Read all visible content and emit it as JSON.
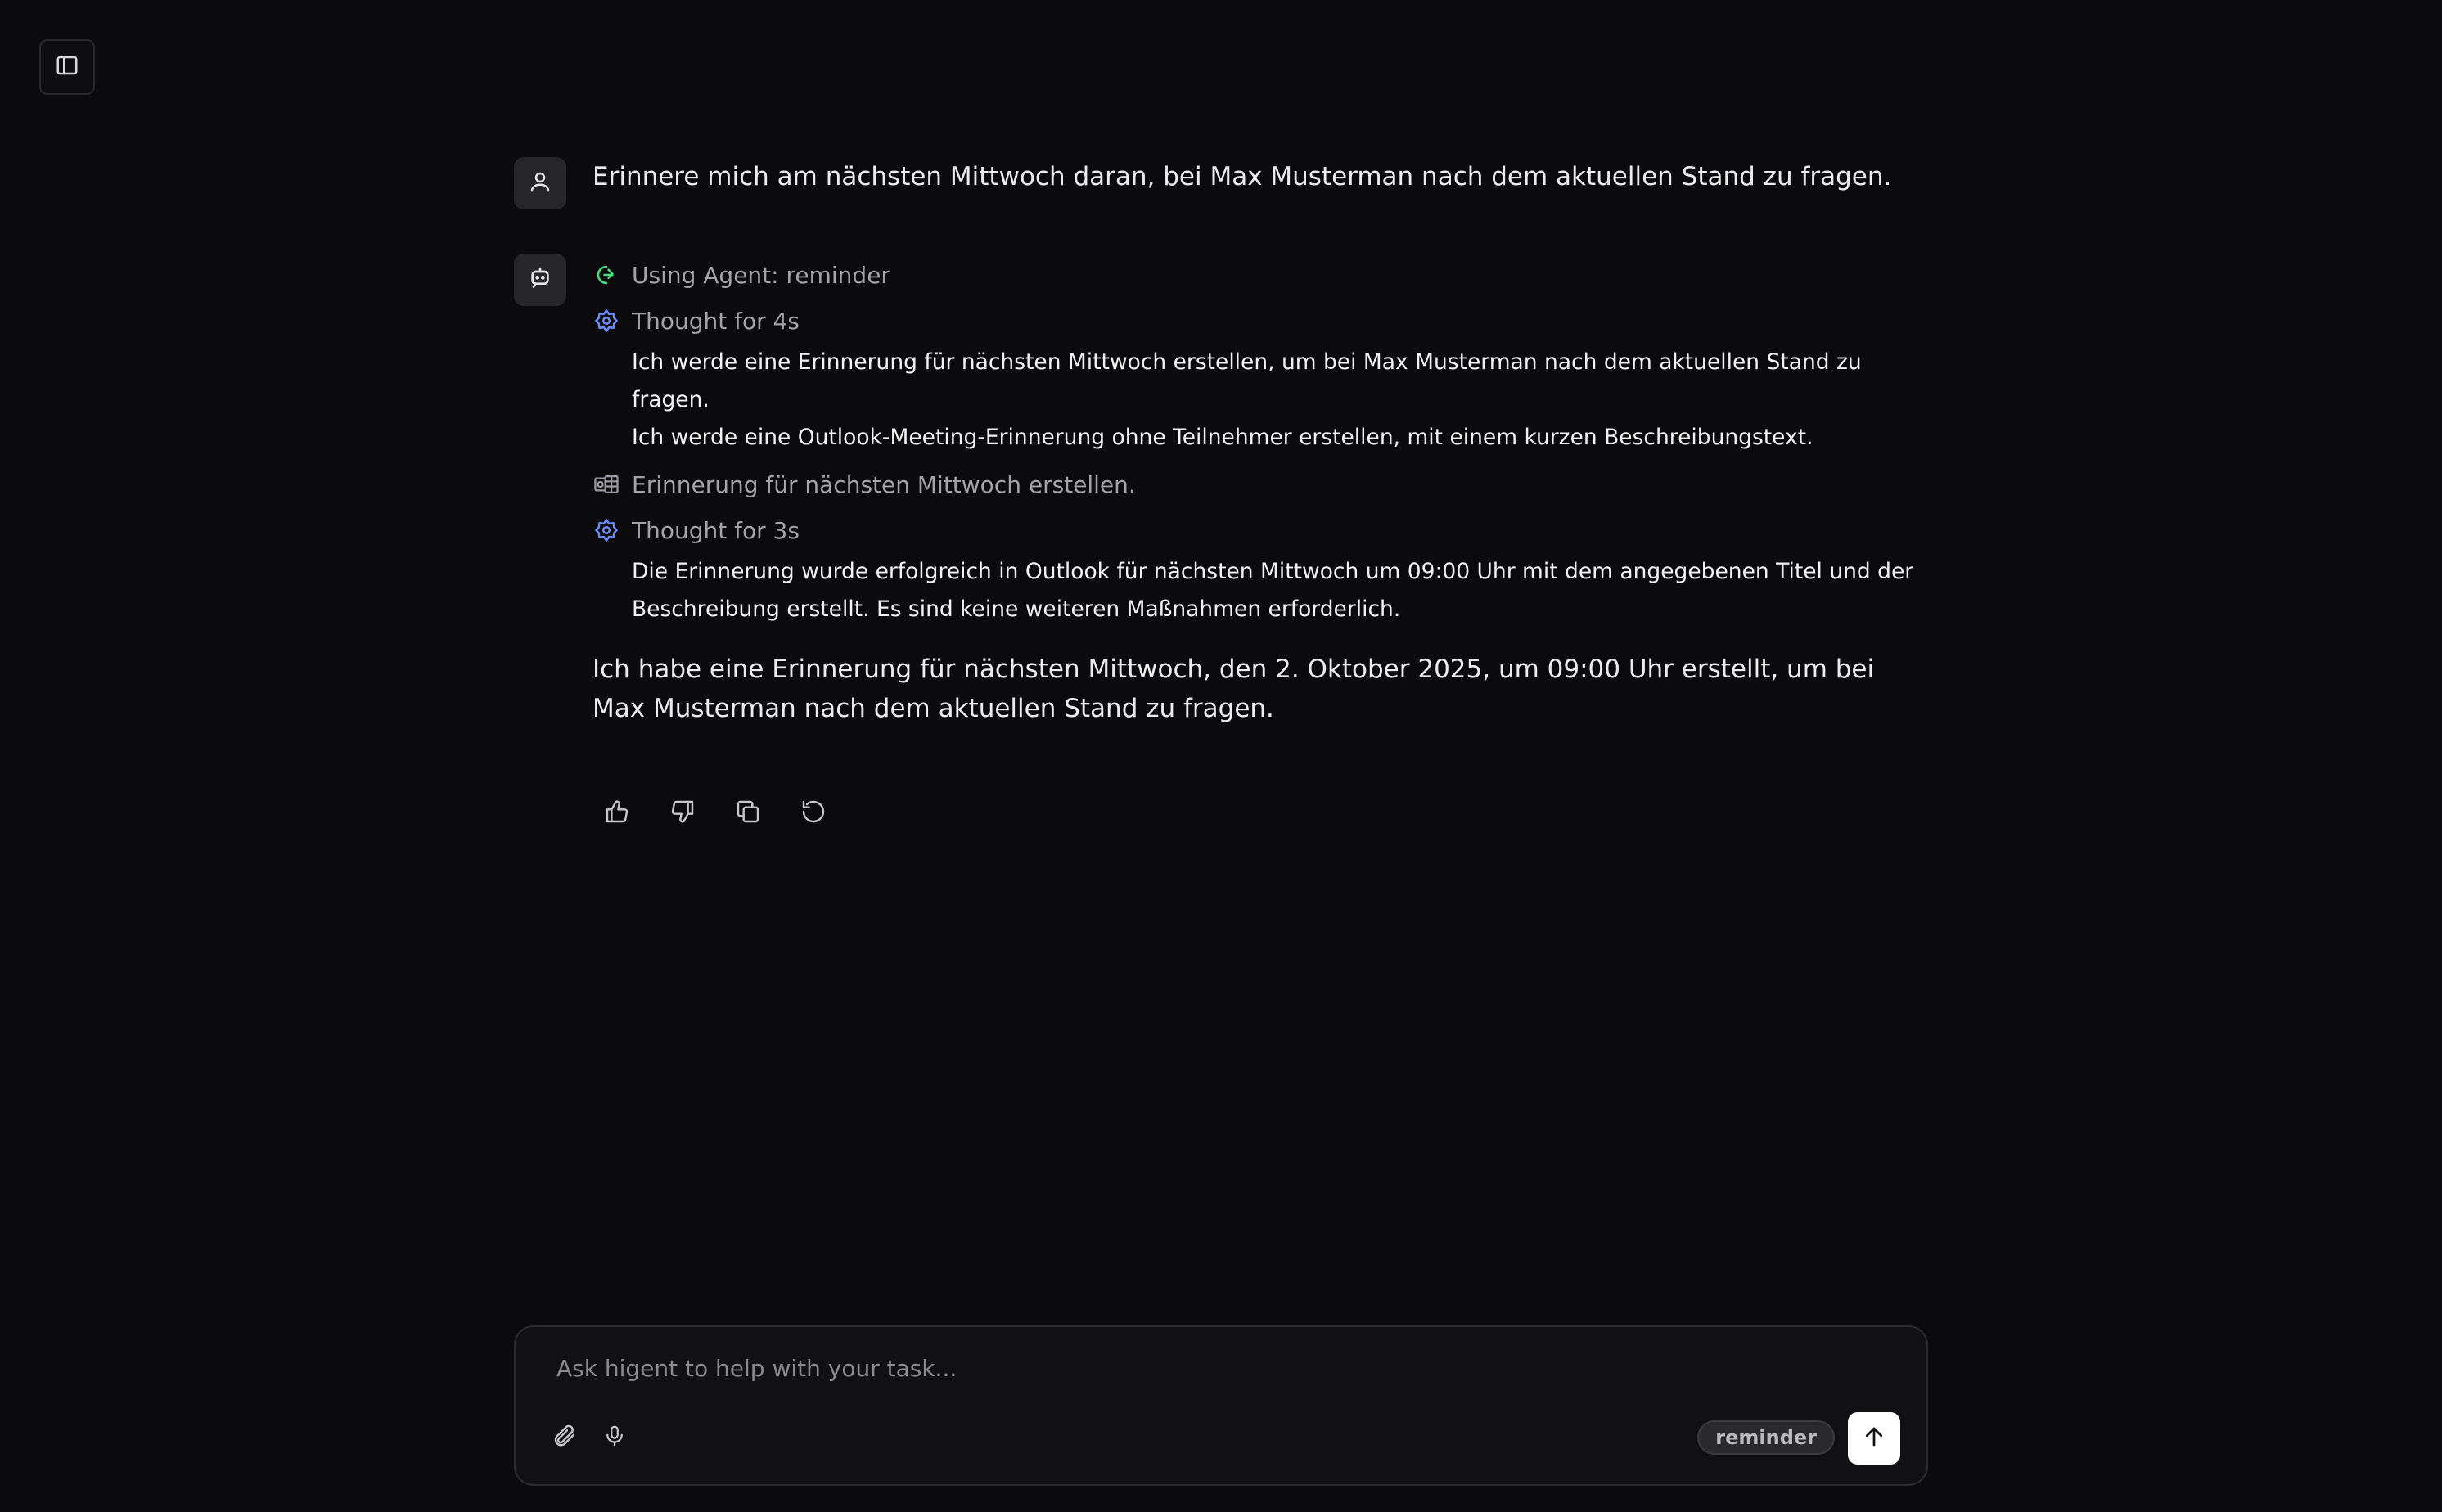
{
  "sidebar": {
    "toggle_icon": "sidebar-panel-icon"
  },
  "conversation": {
    "user_message": "Erinnere mich am nächsten Mittwoch daran, bei Max Musterman nach dem aktuellen Stand zu fragen.",
    "assistant": {
      "steps": [
        {
          "icon": "agent-icon",
          "label": "Using Agent: reminder"
        },
        {
          "icon": "thought-icon",
          "label": "Thought for 4s",
          "body": [
            "Ich werde eine Erinnerung für nächsten Mittwoch erstellen, um bei Max Musterman nach dem aktuellen Stand zu fragen.",
            "Ich werde eine Outlook-Meeting-Erinnerung ohne Teilnehmer erstellen, mit einem kurzen Beschreibungstext."
          ]
        },
        {
          "icon": "outlook-icon",
          "label": "Erinnerung für nächsten Mittwoch erstellen."
        },
        {
          "icon": "thought-icon",
          "label": "Thought for 3s",
          "body": [
            "Die Erinnerung wurde erfolgreich in Outlook für nächsten Mittwoch um 09:00 Uhr mit dem angegebenen Titel und der Beschreibung erstellt. Es sind keine weiteren Maßnahmen erforderlich."
          ]
        }
      ],
      "final_answer": "Ich habe eine Erinnerung für nächsten Mittwoch, den 2. Oktober 2025, um 09:00 Uhr erstellt, um bei Max Musterman nach dem aktuellen Stand zu fragen.",
      "actions": [
        "thumbs-up-icon",
        "thumbs-down-icon",
        "copy-icon",
        "regenerate-icon"
      ]
    }
  },
  "composer": {
    "placeholder": "Ask higent to help with your task...",
    "value": "",
    "agent_badge": "reminder"
  },
  "colors": {
    "background": "#0b0b0d",
    "agent_icon": "#4ade80",
    "thought_icon": "#6b8cff",
    "send_button": "#ffffff"
  }
}
